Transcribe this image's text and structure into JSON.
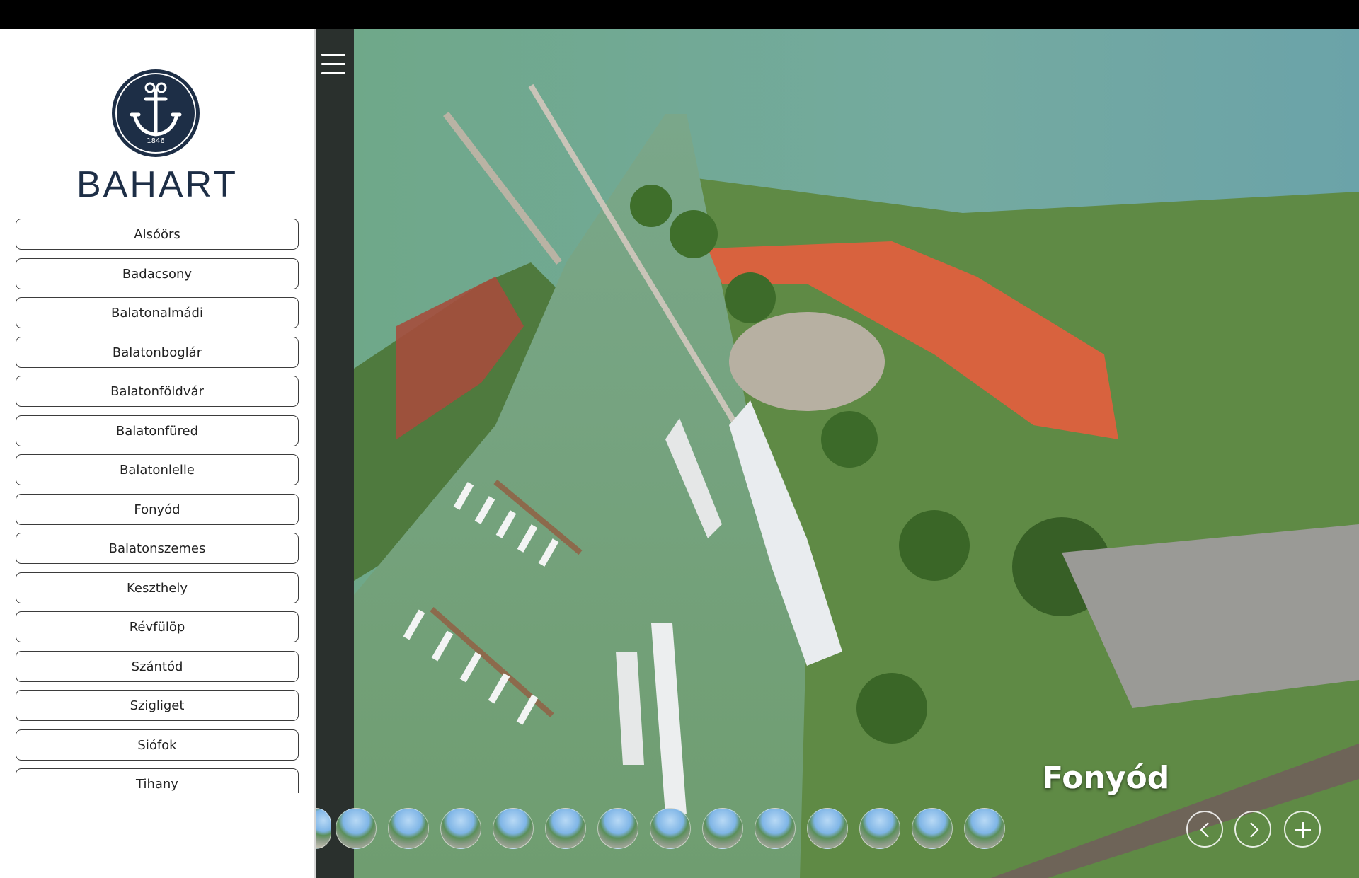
{
  "brand": {
    "name": "BAHART",
    "year": "1846"
  },
  "locations": [
    "Alsóörs",
    "Badacsony",
    "Balatonalmádi",
    "Balatonboglár",
    "Balatonföldvár",
    "Balatonfüred",
    "Balatonlelle",
    "Fonyód",
    "Balatonszemes",
    "Keszthely",
    "Révfülöp",
    "Szántód",
    "Szigliget",
    "Siófok",
    "Tihany"
  ],
  "panorama": {
    "title": "Fonyód"
  },
  "colors": {
    "navy": "#1d2e46",
    "strip": "#2a302d",
    "water": "#73a286",
    "roof": "#d8623e"
  },
  "icons": {
    "menu": "menu-icon",
    "prev": "chevron-left-icon",
    "next": "chevron-right-icon",
    "expand": "plus-icon"
  }
}
